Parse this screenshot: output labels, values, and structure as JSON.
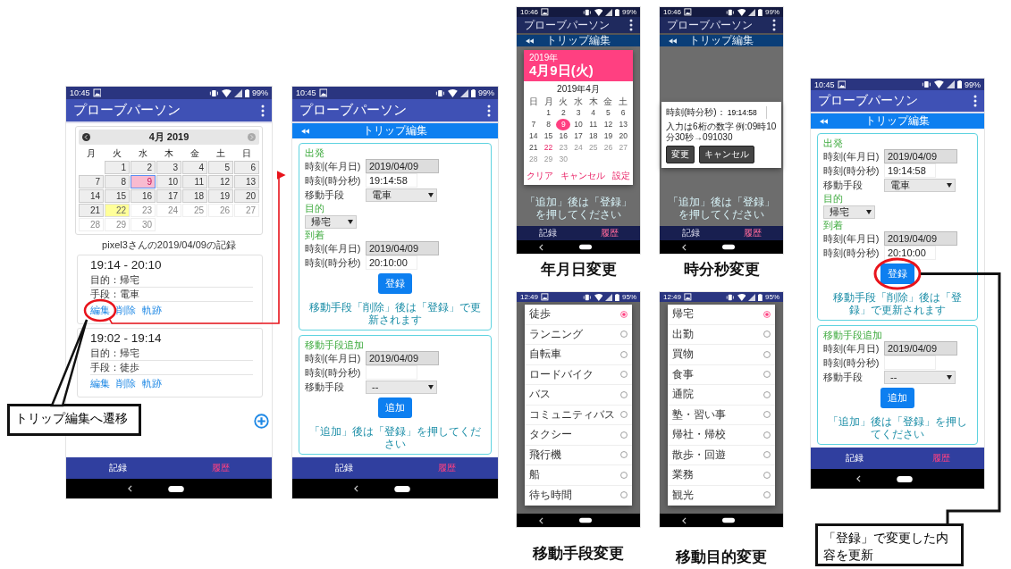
{
  "panels": [
    {
      "kind": "record",
      "status": {
        "time": "10:45",
        "battery": "99%"
      },
      "app_title": "プローブパーソン",
      "calendar": {
        "month": "4月 2019",
        "weekdays": [
          "月",
          "火",
          "水",
          "木",
          "金",
          "土",
          "日"
        ],
        "days": [
          {
            "kind": "blank"
          },
          {
            "kind": "day",
            "label": "1",
            "selected": false,
            "today": false,
            "disabled": false
          },
          {
            "kind": "day",
            "label": "2",
            "selected": false,
            "today": false,
            "disabled": false
          },
          {
            "kind": "day",
            "label": "3",
            "selected": false,
            "today": false,
            "disabled": false
          },
          {
            "kind": "day",
            "label": "4",
            "selected": false,
            "today": false,
            "disabled": false
          },
          {
            "kind": "day",
            "label": "5",
            "selected": false,
            "today": false,
            "disabled": false
          },
          {
            "kind": "day",
            "label": "6",
            "selected": false,
            "today": false,
            "disabled": false
          },
          {
            "kind": "day",
            "label": "7",
            "selected": false,
            "today": false,
            "disabled": false
          },
          {
            "kind": "day",
            "label": "8",
            "selected": false,
            "today": false,
            "disabled": false
          },
          {
            "kind": "day",
            "label": "9",
            "selected": true,
            "today": false,
            "disabled": false
          },
          {
            "kind": "day",
            "label": "10",
            "selected": false,
            "today": false,
            "disabled": false
          },
          {
            "kind": "day",
            "label": "11",
            "selected": false,
            "today": false,
            "disabled": false
          },
          {
            "kind": "day",
            "label": "12",
            "selected": false,
            "today": false,
            "disabled": false
          },
          {
            "kind": "day",
            "label": "13",
            "selected": false,
            "today": false,
            "disabled": false
          },
          {
            "kind": "day",
            "label": "14",
            "selected": false,
            "today": false,
            "disabled": false
          },
          {
            "kind": "day",
            "label": "15",
            "selected": false,
            "today": false,
            "disabled": false
          },
          {
            "kind": "day",
            "label": "16",
            "selected": false,
            "today": false,
            "disabled": false
          },
          {
            "kind": "day",
            "label": "17",
            "selected": false,
            "today": false,
            "disabled": false
          },
          {
            "kind": "day",
            "label": "18",
            "selected": false,
            "today": false,
            "disabled": false
          },
          {
            "kind": "day",
            "label": "19",
            "selected": false,
            "today": false,
            "disabled": false
          },
          {
            "kind": "day",
            "label": "20",
            "selected": false,
            "today": false,
            "disabled": false
          },
          {
            "kind": "day",
            "label": "21",
            "selected": false,
            "today": false,
            "disabled": false
          },
          {
            "kind": "day",
            "label": "22",
            "selected": false,
            "today": true,
            "disabled": false
          },
          {
            "kind": "day",
            "label": "23",
            "selected": false,
            "today": false,
            "disabled": true
          },
          {
            "kind": "day",
            "label": "24",
            "selected": false,
            "today": false,
            "disabled": true
          },
          {
            "kind": "day",
            "label": "25",
            "selected": false,
            "today": false,
            "disabled": true
          },
          {
            "kind": "day",
            "label": "26",
            "selected": false,
            "today": false,
            "disabled": true
          },
          {
            "kind": "day",
            "label": "27",
            "selected": false,
            "today": false,
            "disabled": true
          },
          {
            "kind": "day",
            "label": "28",
            "selected": false,
            "today": false,
            "disabled": true
          },
          {
            "kind": "day",
            "label": "29",
            "selected": false,
            "today": false,
            "disabled": true
          },
          {
            "kind": "day",
            "label": "30",
            "selected": false,
            "today": false,
            "disabled": true
          }
        ]
      },
      "heading": "pixel3さんの2019/04/09の記録",
      "trips": [
        {
          "time": "19:14 - 20:10",
          "details": [
            "目的：帰宅",
            "手段：電車"
          ],
          "actions": [
            "編集",
            "削除",
            "軌跡"
          ]
        },
        {
          "time": "19:02 - 19:14",
          "details": [
            "目的：帰宅",
            "手段：徒歩"
          ],
          "actions": [
            "編集",
            "削除",
            "軌跡"
          ]
        }
      ],
      "nav": [
        {
          "label": "記録",
          "selected": false
        },
        {
          "label": "履歴",
          "selected": true
        }
      ]
    },
    {
      "kind": "edit",
      "status": {
        "time": "10:45",
        "battery": "99%"
      },
      "app_title": "プローブパーソン",
      "header": "トリップ編集",
      "cards": [
        {
          "items": [
            {
              "kind": "heading",
              "text": "出発"
            },
            {
              "kind": "field",
              "label": "時刻(年月日)",
              "value": "2019/04/09",
              "disabled": true
            },
            {
              "kind": "field",
              "label": "時刻(時分秒)",
              "value": "19:14:58",
              "disabled": false
            },
            {
              "kind": "select",
              "label": "移動手段",
              "value": "電車"
            },
            {
              "kind": "heading",
              "text": "目的"
            },
            {
              "kind": "select",
              "value": "帰宅"
            },
            {
              "kind": "heading",
              "text": "到着"
            },
            {
              "kind": "field",
              "label": "時刻(年月日)",
              "value": "2019/04/09",
              "disabled": true
            },
            {
              "kind": "field",
              "label": "時刻(時分秒)",
              "value": "20:10:00",
              "disabled": false
            },
            {
              "kind": "button",
              "text": "登録"
            },
            {
              "kind": "note",
              "text": "移動手段「削除」後は「登録」で更新されます"
            }
          ]
        },
        {
          "items": [
            {
              "kind": "heading",
              "text": "移動手段追加"
            },
            {
              "kind": "field",
              "label": "時刻(年月日)",
              "value": "2019/04/09",
              "disabled": true
            },
            {
              "kind": "field",
              "label": "時刻(時分秒)",
              "disabled": false
            },
            {
              "kind": "select",
              "label": "移動手段",
              "value": "--"
            },
            {
              "kind": "button",
              "text": "追加"
            },
            {
              "kind": "note",
              "text": "「追加」後は「登録」を押してください"
            }
          ]
        }
      ],
      "nav": [
        {
          "label": "記録",
          "selected": false
        },
        {
          "label": "履歴",
          "selected": true
        }
      ]
    },
    {
      "kind": "date_picker",
      "status": {
        "time": "10:46",
        "battery": "99%"
      },
      "app_title": "プローブパーソン",
      "header": "トリップ編集",
      "background_note": "「追加」後は「登録」を押してください",
      "dialog": {
        "year": "2019年",
        "date": "4月9日(火)",
        "month": "2019年4月",
        "weekdays": [
          "日",
          "月",
          "火",
          "水",
          "木",
          "金",
          "土"
        ],
        "days": [
          {
            "kind": "blank"
          },
          {
            "kind": "day",
            "label": "1",
            "selected": false,
            "today": false,
            "disabled": false
          },
          {
            "kind": "day",
            "label": "2",
            "selected": false,
            "today": false,
            "disabled": false
          },
          {
            "kind": "day",
            "label": "3",
            "selected": false,
            "today": false,
            "disabled": false
          },
          {
            "kind": "day",
            "label": "4",
            "selected": false,
            "today": false,
            "disabled": false
          },
          {
            "kind": "day",
            "label": "5",
            "selected": false,
            "today": false,
            "disabled": false
          },
          {
            "kind": "day",
            "label": "6",
            "selected": false,
            "today": false,
            "disabled": false
          },
          {
            "kind": "day",
            "label": "7",
            "selected": false,
            "today": false,
            "disabled": false
          },
          {
            "kind": "day",
            "label": "8",
            "selected": false,
            "today": false,
            "disabled": false
          },
          {
            "kind": "day",
            "label": "9",
            "selected": true,
            "today": false,
            "disabled": false
          },
          {
            "kind": "day",
            "label": "10",
            "selected": false,
            "today": false,
            "disabled": false
          },
          {
            "kind": "day",
            "label": "11",
            "selected": false,
            "today": false,
            "disabled": false
          },
          {
            "kind": "day",
            "label": "12",
            "selected": false,
            "today": false,
            "disabled": false
          },
          {
            "kind": "day",
            "label": "13",
            "selected": false,
            "today": false,
            "disabled": false
          },
          {
            "kind": "day",
            "label": "14",
            "selected": false,
            "today": false,
            "disabled": false
          },
          {
            "kind": "day",
            "label": "15",
            "selected": false,
            "today": false,
            "disabled": false
          },
          {
            "kind": "day",
            "label": "16",
            "selected": false,
            "today": false,
            "disabled": false
          },
          {
            "kind": "day",
            "label": "17",
            "selected": false,
            "today": false,
            "disabled": false
          },
          {
            "kind": "day",
            "label": "18",
            "selected": false,
            "today": false,
            "disabled": false
          },
          {
            "kind": "day",
            "label": "19",
            "selected": false,
            "today": false,
            "disabled": false
          },
          {
            "kind": "day",
            "label": "20",
            "selected": false,
            "today": false,
            "disabled": false
          },
          {
            "kind": "day",
            "label": "21",
            "selected": false,
            "today": false,
            "disabled": false
          },
          {
            "kind": "day",
            "label": "22",
            "selected": false,
            "today": true,
            "disabled": false
          },
          {
            "kind": "day",
            "label": "23",
            "selected": false,
            "today": false,
            "disabled": true
          },
          {
            "kind": "day",
            "label": "24",
            "selected": false,
            "today": false,
            "disabled": true
          },
          {
            "kind": "day",
            "label": "25",
            "selected": false,
            "today": false,
            "disabled": true
          },
          {
            "kind": "day",
            "label": "26",
            "selected": false,
            "today": false,
            "disabled": true
          },
          {
            "kind": "day",
            "label": "27",
            "selected": false,
            "today": false,
            "disabled": true
          },
          {
            "kind": "day",
            "label": "28",
            "selected": false,
            "today": false,
            "disabled": true
          },
          {
            "kind": "day",
            "label": "29",
            "selected": false,
            "today": false,
            "disabled": true
          },
          {
            "kind": "day",
            "label": "30",
            "selected": false,
            "today": false,
            "disabled": true
          }
        ],
        "buttons": [
          "クリア",
          "キャンセル",
          "設定"
        ]
      },
      "nav": [
        {
          "label": "記録",
          "selected": false
        },
        {
          "label": "履歴",
          "selected": true
        }
      ],
      "caption": "年月日変更"
    },
    {
      "kind": "time_input",
      "status": {
        "time": "10:46",
        "battery": "99%"
      },
      "app_title": "プローブパーソン",
      "header": "トリップ編集",
      "background_note": "「追加」後は「登録」を押してください",
      "dialog": {
        "label": "時刻(時分秒)：",
        "value": "19:14:58",
        "hint": "入力は6桁の数字 例:09時10分30秒→091030",
        "buttons": [
          "変更",
          "キャンセル"
        ]
      },
      "nav": [
        {
          "label": "記録",
          "selected": false
        },
        {
          "label": "履歴",
          "selected": true
        }
      ],
      "caption": "時分秒変更"
    },
    {
      "kind": "choice_list",
      "status": {
        "time": "12:49",
        "battery": "95%"
      },
      "options": [
        {
          "label": "徒歩",
          "selected": true
        },
        {
          "label": "ランニング",
          "selected": false
        },
        {
          "label": "自転車",
          "selected": false
        },
        {
          "label": "ロードバイク",
          "selected": false
        },
        {
          "label": "バス",
          "selected": false
        },
        {
          "label": "コミュニティバス",
          "selected": false
        },
        {
          "label": "タクシー",
          "selected": false
        },
        {
          "label": "飛行機",
          "selected": false
        },
        {
          "label": "船",
          "selected": false
        },
        {
          "label": "待ち時間",
          "selected": false
        }
      ],
      "caption": "移動手段変更"
    },
    {
      "kind": "choice_list",
      "status": {
        "time": "12:49",
        "battery": "95%"
      },
      "options": [
        {
          "label": "帰宅",
          "selected": true
        },
        {
          "label": "出勤",
          "selected": false
        },
        {
          "label": "買物",
          "selected": false
        },
        {
          "label": "食事",
          "selected": false
        },
        {
          "label": "通院",
          "selected": false
        },
        {
          "label": "塾・習い事",
          "selected": false
        },
        {
          "label": "帰社・帰校",
          "selected": false
        },
        {
          "label": "散歩・回遊",
          "selected": false
        },
        {
          "label": "業務",
          "selected": false
        },
        {
          "label": "観光",
          "selected": false
        }
      ],
      "caption": "移動目的変更"
    },
    {
      "kind": "edit",
      "status": {
        "time": "10:45",
        "battery": "99%"
      },
      "app_title": "プローブパーソン",
      "header": "トリップ編集",
      "cards": [
        {
          "items": [
            {
              "kind": "heading",
              "text": "出発"
            },
            {
              "kind": "field",
              "label": "時刻(年月日)",
              "value": "2019/04/09",
              "disabled": true
            },
            {
              "kind": "field",
              "label": "時刻(時分秒)",
              "value": "19:14:58",
              "disabled": false
            },
            {
              "kind": "select",
              "label": "移動手段",
              "value": "電車"
            },
            {
              "kind": "heading",
              "text": "目的"
            },
            {
              "kind": "select",
              "value": "帰宅"
            },
            {
              "kind": "heading",
              "text": "到着"
            },
            {
              "kind": "field",
              "label": "時刻(年月日)",
              "value": "2019/04/09",
              "disabled": true
            },
            {
              "kind": "field",
              "label": "時刻(時分秒)",
              "value": "20:10:00",
              "disabled": false
            },
            {
              "kind": "button",
              "text": "登録"
            },
            {
              "kind": "note",
              "text": "移動手段「削除」後は「登録」で更新されます"
            }
          ]
        },
        {
          "items": [
            {
              "kind": "heading",
              "text": "移動手段追加"
            },
            {
              "kind": "field",
              "label": "時刻(年月日)",
              "value": "2019/04/09",
              "disabled": true
            },
            {
              "kind": "field",
              "label": "時刻(時分秒)",
              "disabled": false
            },
            {
              "kind": "select",
              "label": "移動手段",
              "value": "--"
            },
            {
              "kind": "button",
              "text": "追加"
            },
            {
              "kind": "note",
              "text": "「追加」後は「登録」を押してください"
            }
          ]
        }
      ],
      "nav": [
        {
          "label": "記録",
          "selected": false
        },
        {
          "label": "履歴",
          "selected": true
        }
      ]
    }
  ],
  "callouts": [
    {
      "text": "トリップ編集へ遷移"
    },
    {
      "text": "「登録」で変更した内容を更新"
    }
  ]
}
